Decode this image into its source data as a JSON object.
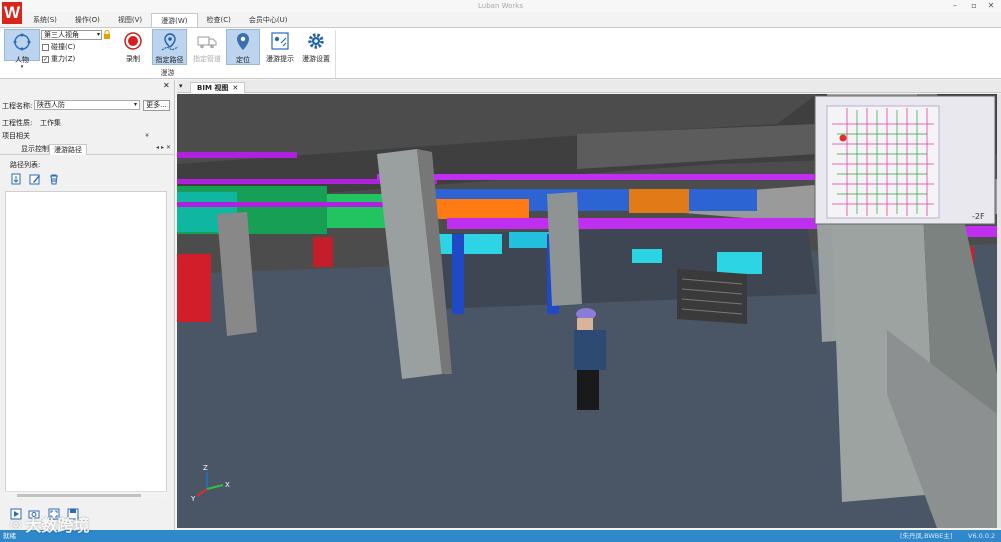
{
  "app": {
    "title": "Luban Works",
    "logo_letter": "W"
  },
  "menu": {
    "items": [
      "系统(S)",
      "操作(O)",
      "视图(V)",
      "漫游(W)",
      "检查(C)",
      "会员中心(U)"
    ],
    "active_index": 3
  },
  "ribbon": {
    "person_label": "人物",
    "view_mode": "第三人视角",
    "checkbox_collision": {
      "label": "碰撞(C)",
      "checked": false
    },
    "checkbox_gravity": {
      "label": "重力(Z)",
      "checked": true
    },
    "record_label": "录制",
    "specify_path_label": "指定路径",
    "pipe_label": "指定管道",
    "locate_label": "定位",
    "tips_label": "漫游提示",
    "settings_label": "漫游设置",
    "group_label": "漫游"
  },
  "left_panel": {
    "project_name_label": "工程名称:",
    "project_name_value": "陕西人防",
    "more_label": "更多...",
    "project_type_label": "工程性质:",
    "project_type_value": "工作集",
    "related_label": "项目相关",
    "collapse_glyph": "»",
    "tabs": [
      "显示控制",
      "漫游路径"
    ],
    "active_tab": 1,
    "path_list_label": "路径列表:"
  },
  "viewport": {
    "tab_label": "BIM 视图",
    "minimap_floor": "-2F",
    "axis_labels": {
      "x": "X",
      "y": "Y",
      "z": "Z"
    }
  },
  "status": {
    "text": "就绪",
    "user": "[朱丹凤,BWBE主]",
    "version": "V6.0.0.2"
  },
  "watermark": "大数跨境",
  "colors": {
    "status_bar": "#2f88c9",
    "pipe_magenta": "#b020e0",
    "duct_green": "#1fc46a",
    "floor": "#4a5565",
    "ceiling": "#4c4c4c"
  }
}
